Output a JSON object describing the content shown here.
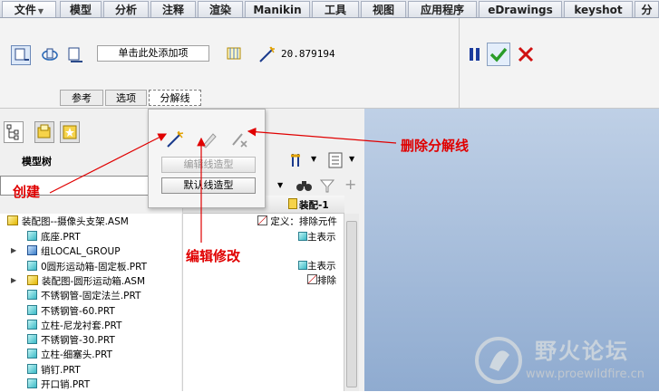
{
  "menu": {
    "items": [
      "文件",
      "模型",
      "分析",
      "注释",
      "渲染",
      "Manikin",
      "工具",
      "视图",
      "应用程序",
      "eDrawings",
      "keyshot",
      "分"
    ]
  },
  "ribbon": {
    "add_item_label": "单击此处添加项",
    "value": "20.879194",
    "sub_tabs": [
      "参考",
      "选项",
      "分解线"
    ],
    "active_sub_tab": "分解线"
  },
  "popup": {
    "edit_style_label": "编辑线造型",
    "default_style_label": "默认线造型"
  },
  "left_panel": {
    "tree_title": "模型树",
    "column_header": "装配-1",
    "tree_items": [
      {
        "label": "装配图--摄像头支架.ASM",
        "kind": "asm"
      },
      {
        "label": "底座.PRT",
        "kind": "part"
      },
      {
        "label": "组LOCAL_GROUP",
        "kind": "group"
      },
      {
        "label": "0圆形运动箱-固定板.PRT",
        "kind": "part"
      },
      {
        "label": "装配图-圆形运动箱.ASM",
        "kind": "asm"
      },
      {
        "label": "不锈钢管-固定法兰.PRT",
        "kind": "part"
      },
      {
        "label": "不锈钢管-60.PRT",
        "kind": "part"
      },
      {
        "label": "立柱-尼龙衬套.PRT",
        "kind": "part"
      },
      {
        "label": "不锈钢管-30.PRT",
        "kind": "part"
      },
      {
        "label": "立柱-细塞头.PRT",
        "kind": "part"
      },
      {
        "label": "销钉.PRT",
        "kind": "part"
      },
      {
        "label": "开口销.PRT",
        "kind": "part"
      }
    ],
    "right_texts": [
      "定义：排除元件",
      "主表示",
      "主表示",
      "排除"
    ]
  },
  "annotations": {
    "create": "创建",
    "edit": "编辑修改",
    "delete": "删除分解线"
  },
  "watermark": {
    "title": "野火论坛",
    "url": "www.proewildfire.cn"
  },
  "colors": {
    "annotation_red": "#e00000",
    "confirm_green": "#2a9c2a",
    "cancel_red": "#d01010",
    "pause_blue": "#1a3a9c"
  }
}
